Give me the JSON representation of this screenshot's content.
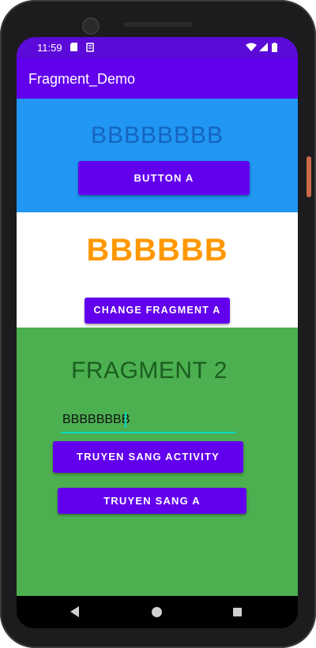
{
  "status_bar": {
    "time": "11:59",
    "icons": [
      "sim-card-icon",
      "sd-card-icon",
      "wifi-icon",
      "signal-icon",
      "battery-icon"
    ]
  },
  "app_bar": {
    "title": "Fragment_Demo"
  },
  "fragment_top": {
    "text": "BBBBBBBB",
    "button_label": "BUTTON A"
  },
  "fragment_middle": {
    "text": "BBBBBB",
    "button_label": "CHANGE FRAGMENT A"
  },
  "fragment_two": {
    "title": "FRAGMENT 2",
    "input_value": "BBBBBBBB",
    "button_activity_label": "TRUYEN SANG ACTIVITY",
    "button_a_label": "TRUYEN SANG A"
  },
  "nav_bar": {
    "icons": [
      "back-icon",
      "home-icon",
      "recents-icon"
    ]
  },
  "colors": {
    "primary": "#6200ee",
    "status_bar": "#5b0ad9",
    "fragment_top_bg": "#2196f3",
    "fragment_middle_text": "#ff9800",
    "fragment_two_bg": "#4caf50",
    "accent": "#03dac5"
  }
}
